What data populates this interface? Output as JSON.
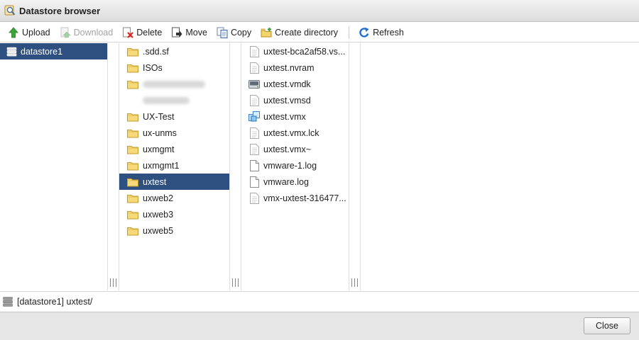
{
  "window": {
    "title": "Datastore browser"
  },
  "toolbar": {
    "upload": "Upload",
    "download": "Download",
    "delete": "Delete",
    "move": "Move",
    "copy": "Copy",
    "create_directory": "Create directory",
    "refresh": "Refresh"
  },
  "datastores": [
    {
      "label": "datastore1",
      "selected": true
    }
  ],
  "directories": [
    {
      "label": ".sdd.sf",
      "icon": "folder-icon"
    },
    {
      "label": "ISOs",
      "icon": "folder-icon"
    },
    {
      "label": "",
      "icon": "folder-icon",
      "redacted": true
    },
    {
      "label": "",
      "icon": "none",
      "redacted": true
    },
    {
      "label": "UX-Test",
      "icon": "folder-icon"
    },
    {
      "label": "ux-unms",
      "icon": "folder-icon"
    },
    {
      "label": "uxmgmt",
      "icon": "folder-icon"
    },
    {
      "label": "uxmgmt1",
      "icon": "folder-icon"
    },
    {
      "label": "uxtest",
      "icon": "folder-icon",
      "selected": true
    },
    {
      "label": "uxweb2",
      "icon": "folder-icon"
    },
    {
      "label": "uxweb3",
      "icon": "folder-icon"
    },
    {
      "label": "uxweb5",
      "icon": "folder-icon"
    }
  ],
  "files": [
    {
      "label": "uxtest-bca2af58.vs...",
      "icon": "text-file-icon"
    },
    {
      "label": "uxtest.nvram",
      "icon": "text-file-icon"
    },
    {
      "label": "uxtest.vmdk",
      "icon": "disk-icon"
    },
    {
      "label": "uxtest.vmsd",
      "icon": "text-file-icon"
    },
    {
      "label": "uxtest.vmx",
      "icon": "vm-icon"
    },
    {
      "label": "uxtest.vmx.lck",
      "icon": "text-file-icon"
    },
    {
      "label": "uxtest.vmx~",
      "icon": "text-file-icon"
    },
    {
      "label": "vmware-1.log",
      "icon": "document-icon"
    },
    {
      "label": "vmware.log",
      "icon": "document-icon"
    },
    {
      "label": "vmx-uxtest-316477...",
      "icon": "text-file-icon"
    }
  ],
  "status": {
    "path": "[datastore1] uxtest/"
  },
  "footer": {
    "close": "Close"
  },
  "colors": {
    "selection": "#2d5080",
    "footer_bg": "#e6e6e6"
  }
}
